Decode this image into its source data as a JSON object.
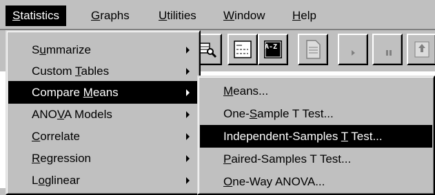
{
  "menubar": {
    "items": [
      {
        "pre": "",
        "mn": "S",
        "post": "tatistics"
      },
      {
        "pre": "",
        "mn": "G",
        "post": "raphs"
      },
      {
        "pre": "",
        "mn": "U",
        "post": "tilities"
      },
      {
        "pre": "",
        "mn": "W",
        "post": "indow"
      },
      {
        "pre": "",
        "mn": "H",
        "post": "elp"
      }
    ]
  },
  "statistics_menu": {
    "items": [
      {
        "pre": "S",
        "mn": "u",
        "post": "mmarize"
      },
      {
        "pre": "Custom ",
        "mn": "T",
        "post": "ables"
      },
      {
        "pre": "Compare ",
        "mn": "M",
        "post": "eans"
      },
      {
        "pre": "ANO",
        "mn": "V",
        "post": "A Models"
      },
      {
        "pre": "",
        "mn": "C",
        "post": "orrelate"
      },
      {
        "pre": "",
        "mn": "R",
        "post": "egression"
      },
      {
        "pre": "L",
        "mn": "o",
        "post": "glinear"
      }
    ]
  },
  "compare_means_menu": {
    "items": [
      {
        "pre": "",
        "mn": "M",
        "post": "eans..."
      },
      {
        "pre": "One-",
        "mn": "S",
        "post": "ample T Test..."
      },
      {
        "pre": "Independent-Samples ",
        "mn": "T",
        "post": " Test..."
      },
      {
        "pre": "",
        "mn": "P",
        "post": "aired-Samples T Test..."
      },
      {
        "pre": "",
        "mn": "O",
        "post": "ne-Way ANOVA..."
      }
    ]
  },
  "toolbar": {
    "az_label": "A-Z"
  }
}
